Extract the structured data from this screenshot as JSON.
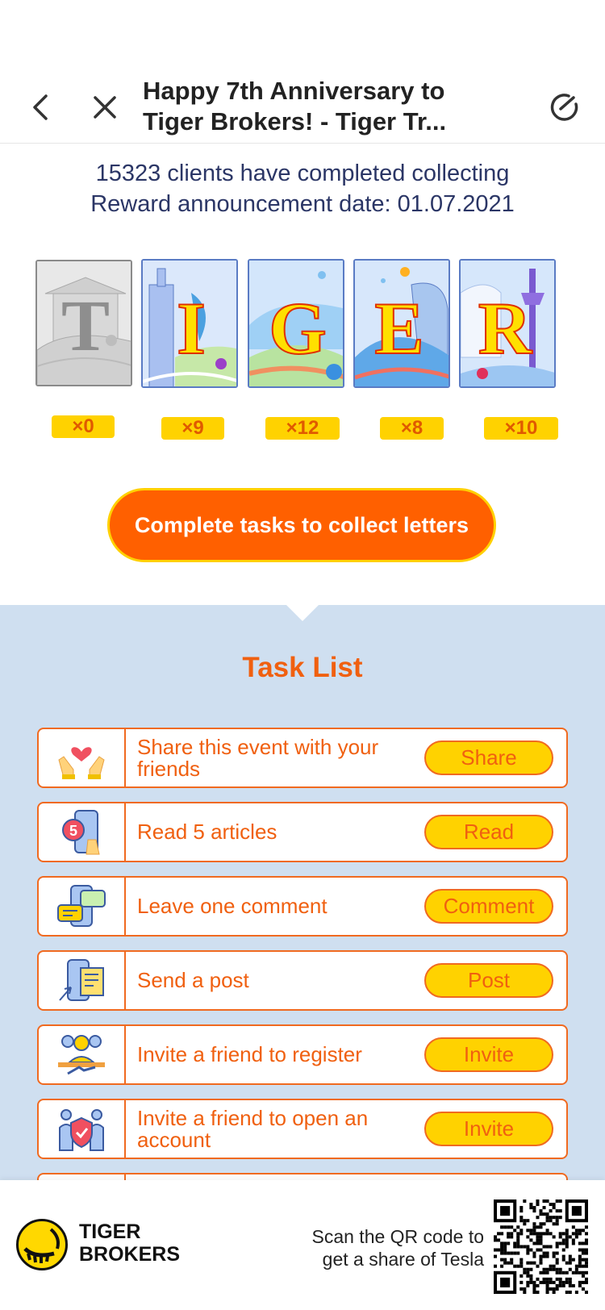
{
  "header": {
    "title_line1": "Happy 7th Anniversary to",
    "title_line2": "Tiger Brokers! - Tiger Tr...",
    "back_icon": "chevron-left-icon",
    "close_icon": "close-icon",
    "refresh_icon": "refresh-icon"
  },
  "stats": {
    "clients": "15323 clients have completed collecting",
    "date": "Reward announcement date: 01.07.2021"
  },
  "cards": [
    {
      "letter": "T",
      "count": "×0",
      "collected": false
    },
    {
      "letter": "I",
      "count": "×9",
      "collected": true
    },
    {
      "letter": "G",
      "count": "×12",
      "collected": true
    },
    {
      "letter": "E",
      "count": "×8",
      "collected": true
    },
    {
      "letter": "R",
      "count": "×10",
      "collected": true
    }
  ],
  "cta": {
    "label": "Complete tasks to collect letters"
  },
  "tasks_title": "Task List",
  "tasks": [
    {
      "label": "Share this event with your friends",
      "button": "Share",
      "icon": "heart-hands-icon"
    },
    {
      "label": "Read 5 articles",
      "button": "Read",
      "icon": "phone-articles-icon"
    },
    {
      "label": "Leave one comment",
      "button": "Comment",
      "icon": "comment-bubbles-icon"
    },
    {
      "label": "Send a post",
      "button": "Post",
      "icon": "post-document-icon"
    },
    {
      "label": "Invite a friend to register",
      "button": "Invite",
      "icon": "handshake-icon"
    },
    {
      "label": "Invite a friend to open an account",
      "button": "Invite",
      "icon": "shield-people-icon"
    }
  ],
  "footer": {
    "brand_line1": "TIGER",
    "brand_line2": "BROKERS",
    "scan_line1": "Scan the QR code to",
    "scan_line2": "get a share of Tesla"
  },
  "colors": {
    "accent_orange": "#ff6000",
    "yellow": "#ffd200",
    "task_bg": "#cfdff0",
    "stats_text": "#2b3666"
  }
}
